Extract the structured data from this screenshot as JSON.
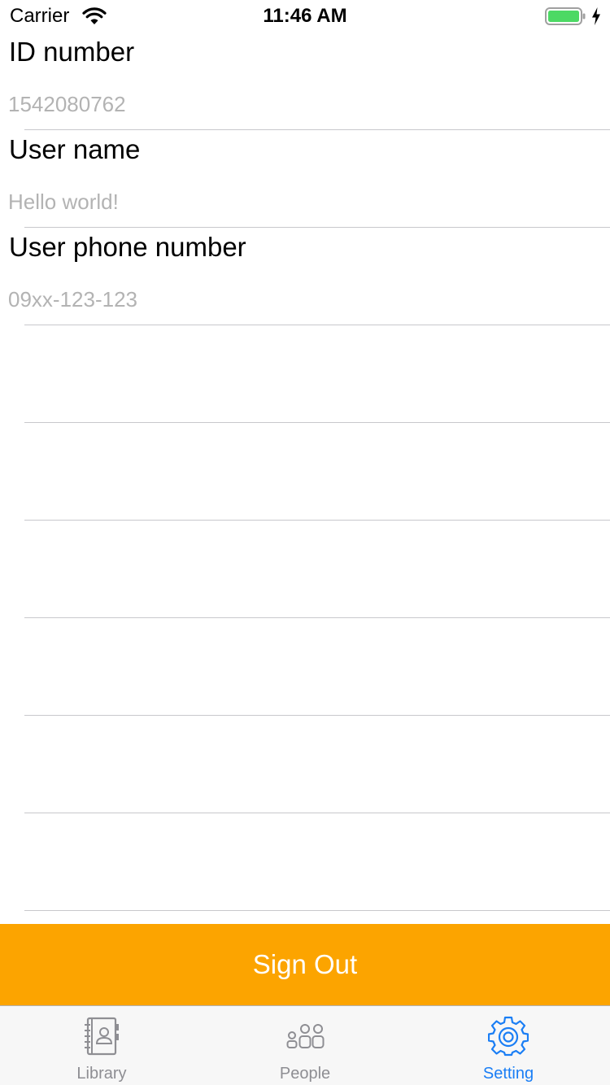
{
  "status_bar": {
    "carrier": "Carrier",
    "time": "11:46 AM",
    "battery_color": "#4cd964"
  },
  "form": {
    "fields": [
      {
        "label": "ID number",
        "placeholder": "1542080762",
        "value": ""
      },
      {
        "label": "User name",
        "placeholder": "Hello world!",
        "value": ""
      },
      {
        "label": "User phone number",
        "placeholder": "09xx-123-123",
        "value": ""
      }
    ]
  },
  "signout": {
    "label": "Sign Out",
    "color": "#fca400"
  },
  "tabbar": {
    "active_color": "#1a7ef5",
    "inactive_color": "#8e8e93",
    "tabs": [
      {
        "label": "Library",
        "icon": "contact-book-icon",
        "active": false
      },
      {
        "label": "People",
        "icon": "people-group-icon",
        "active": false
      },
      {
        "label": "Setting",
        "icon": "gear-icon",
        "active": true
      }
    ]
  }
}
